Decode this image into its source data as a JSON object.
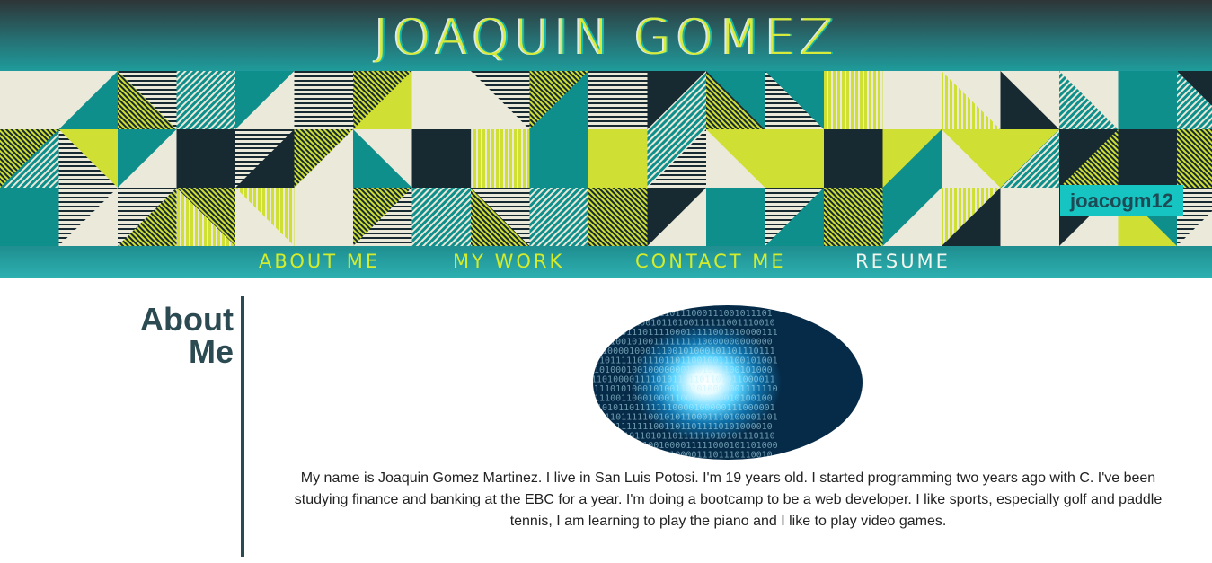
{
  "header": {
    "site_title": "JOAQUIN GOMEZ",
    "colors": {
      "accent_lime": "#d4ec2c",
      "teal": "#16c4c1",
      "dark": "#2c4a52"
    }
  },
  "banner": {
    "pattern_colors": [
      "#cfdf33",
      "#0e8f8c",
      "#172a32",
      "#ebe9da"
    ],
    "handle": "joacogm12"
  },
  "nav": {
    "items": [
      {
        "label": "ABOUT ME"
      },
      {
        "label": "MY WORK"
      },
      {
        "label": "CONTACT ME"
      },
      {
        "label": "RESUME"
      }
    ]
  },
  "about": {
    "heading": "About Me",
    "image_alt": "binary code tunnel",
    "bio": "My name is Joaquin Gomez Martinez. I live in San Luis Potosi. I'm 19 years old. I started programming two years ago with C. I've been studying finance and banking at the EBC for a year. I'm doing a bootcamp to be a web developer. I like sports, especially golf and paddle tennis, I am learning to play the piano and I like to play video games."
  }
}
